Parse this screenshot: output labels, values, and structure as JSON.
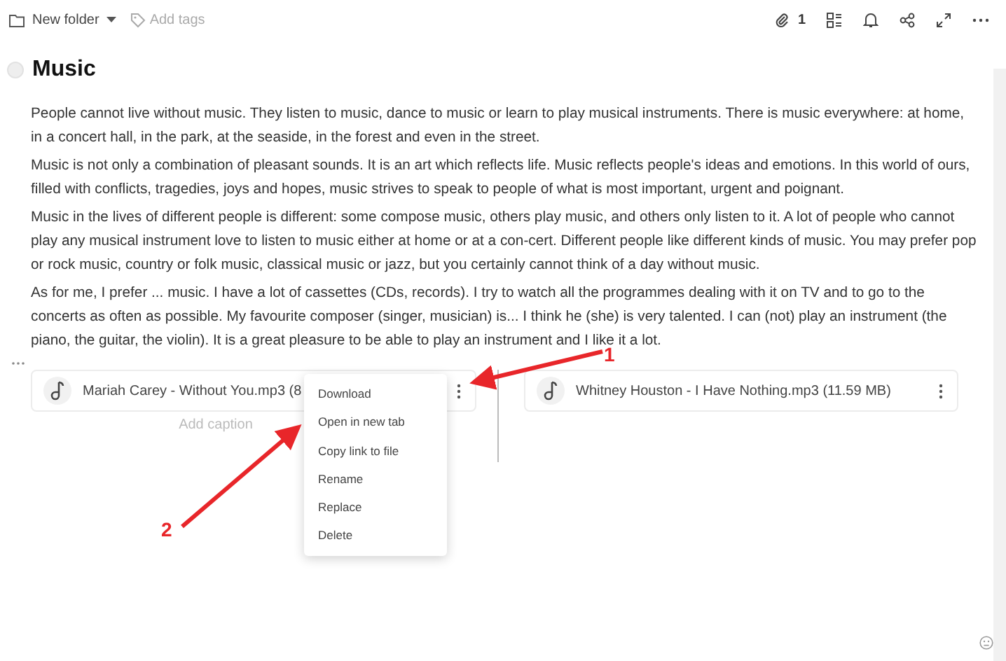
{
  "toolbar": {
    "folder": "New folder",
    "tags_placeholder": "Add tags",
    "attachments_count": "1"
  },
  "title": "Music",
  "paragraphs": [
    "People cannot live without music. They listen to music, dance to music or learn to play musical instruments. There is music everywhere: at home, in a concert hall, in the park, at the seaside, in the forest and even in the street.",
    "Music is not only a combination of pleasant sounds. It is an art which reflects life. Music reflects people's ideas and emotions. In this world of ours, filled with conflicts, tragedies, joys and hopes, music strives to speak to people of what is most important, urgent and poignant.",
    "Music in the lives of different people is different: some compose music, others play music, and others only listen to it. A lot of people who cannot play any musical instrument love to listen to music either at home or at a con-cert. Different people like different kinds of music. You may prefer pop or rock music, country or folk music, classical music or jazz, but you certainly cannot think of a day without music.",
    "As for me, I prefer ... music. I have a lot of cassettes (CDs, records). I try to watch all the programmes dealing with it on TV and to go to the concerts as often as possible. My favourite composer (singer, musician) is... I think he (she) is very talented. I can (not) play an instrument (the piano, the guitar, the violin). It is a great pleasure to be able to play an instrument and I like it a lot."
  ],
  "files": [
    {
      "name": "Mariah Carey - Without You.mp3 (8",
      "caption_placeholder": "Add caption"
    },
    {
      "name": "Whitney Houston - I Have Nothing.mp3 (11.59 MB)"
    }
  ],
  "context_menu": [
    "Download",
    "Open in new tab",
    "Copy link to file",
    "Rename",
    "Replace",
    "Delete"
  ],
  "annotations": [
    "1",
    "2"
  ]
}
